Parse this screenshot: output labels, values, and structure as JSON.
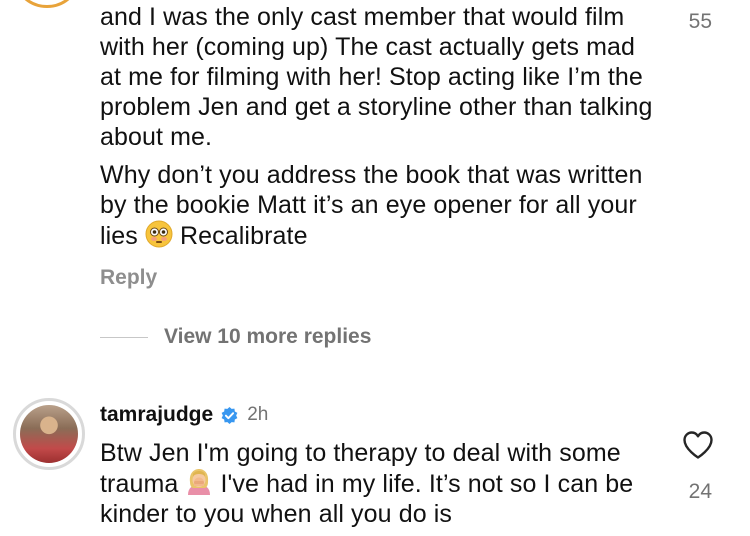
{
  "comment1": {
    "para1": "and I was the only cast member that would film with her (coming up) The cast actually gets mad at me for filming with her!  Stop acting like I’m the problem Jen and get a storyline other than talking about me.",
    "para2_before": "Why don’t you address the book that was written by the bookie Matt it’s an eye opener for all your lies ",
    "para2_after": " Recalibrate",
    "likes": "55",
    "reply_label": "Reply"
  },
  "view_replies": "View 10 more replies",
  "comment2": {
    "username": "tamrajudge",
    "time": "2h",
    "text_before": "Btw Jen I'm going to therapy to deal with some trauma ",
    "text_after": " I've had in my life. It’s not so I can be kinder to you when all you do is",
    "likes": "24"
  },
  "icons": {
    "emoji1": "flushed-face-emoji",
    "emoji2": "woman-facepalming-emoji",
    "verified": "verified-badge-icon",
    "like": "heart-icon"
  },
  "colors": {
    "verified": "#3897f0",
    "muted": "#737373",
    "text": "#111111"
  }
}
